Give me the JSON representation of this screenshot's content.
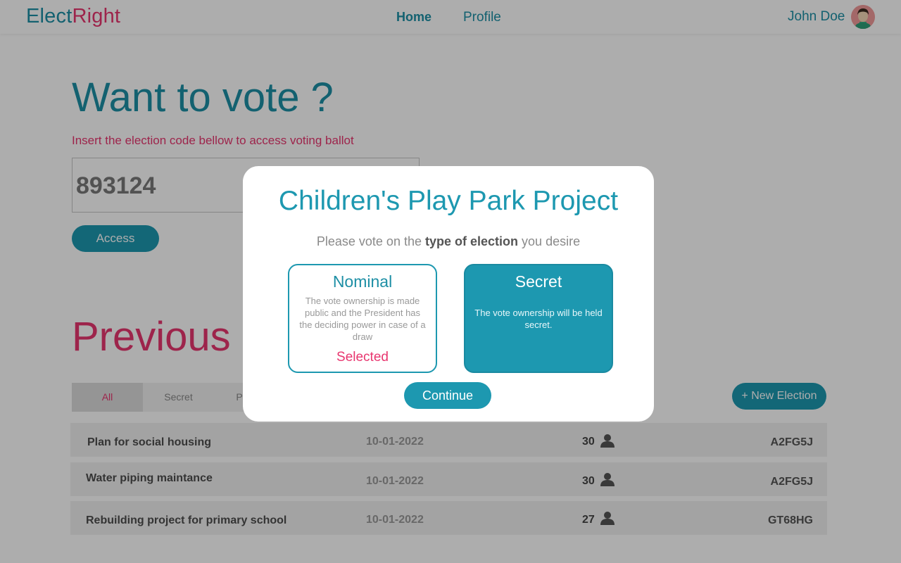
{
  "header": {
    "logo_part1": "Elect",
    "logo_part2": "Right",
    "nav": {
      "home": "Home",
      "profile": "Profile"
    },
    "user_name": "John Doe"
  },
  "vote": {
    "title": "Want to vote ?",
    "subtitle": "Insert the election code bellow to access voting ballot",
    "code_value": "893124",
    "access_label": "Access"
  },
  "previous": {
    "title": "Previous elections",
    "tabs": [
      "All",
      "Secret",
      "Public"
    ],
    "new_election_label": "+ New Election",
    "rows": [
      {
        "name": "Plan for social housing",
        "date": "10-01-2022",
        "count": "30",
        "code": "A2FG5J"
      },
      {
        "name": "Water piping maintance",
        "date": "10-01-2022",
        "count": "30",
        "code": "A2FG5J"
      },
      {
        "name": "Rebuilding project for primary school",
        "date": "10-01-2022",
        "count": "27",
        "code": "GT68HG"
      }
    ]
  },
  "modal": {
    "title": "Children's Play Park Project",
    "prompt_before": "Please vote on the",
    "prompt_strong": "type of election",
    "prompt_after": "you desire",
    "options": [
      {
        "title": "Nominal",
        "description": "The vote ownership is made public and the President has the deciding power in case of a draw",
        "selected_label": "Selected"
      },
      {
        "title": "Secret",
        "description": "The vote ownership will be held secret."
      }
    ],
    "continue_label": "Continue"
  },
  "colors": {
    "primary": "#1d98b0",
    "accent": "#e8366f"
  }
}
